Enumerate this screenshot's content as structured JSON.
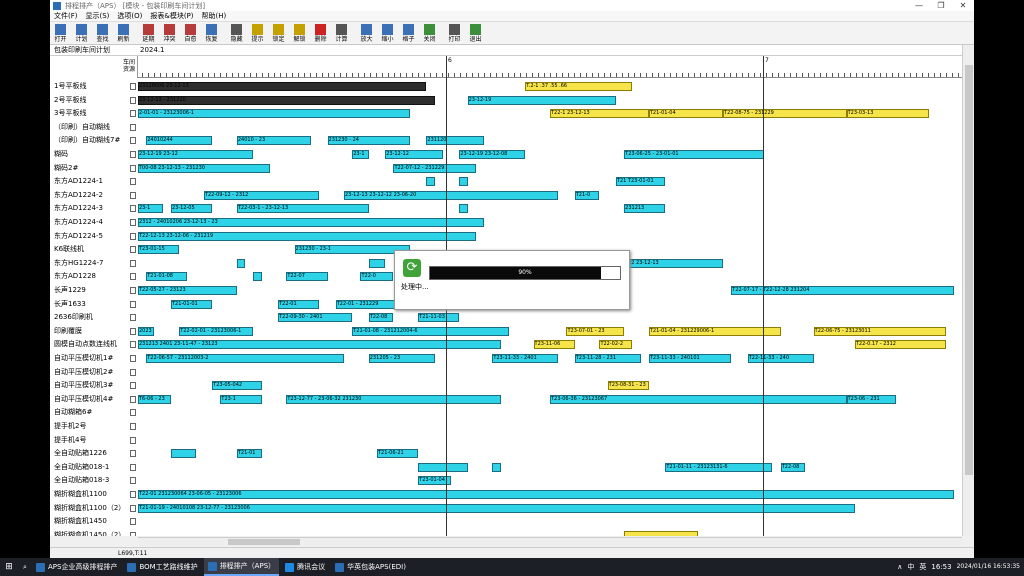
{
  "window": {
    "title": "排程排产（APS）  [模块 - 包装印刷车间计划]",
    "controls": [
      "—",
      "❐",
      "✕"
    ]
  },
  "menu": [
    "文件(F)",
    "显示(S)",
    "选项(O)",
    "报表&模块(P)",
    "帮助(H)"
  ],
  "toolbar": [
    {
      "label": "打开",
      "icon": "open-icon",
      "color": "#3b6fb6"
    },
    {
      "label": "计划",
      "icon": "plan-icon",
      "color": "#3b6fb6"
    },
    {
      "label": "查找",
      "icon": "find-icon",
      "color": "#3b6fb6"
    },
    {
      "label": "刷新",
      "icon": "refresh-icon",
      "color": "#3b6fb6"
    },
    {
      "label": "延期",
      "icon": "delay-icon",
      "color": "#b63b3b"
    },
    {
      "label": "冲突",
      "icon": "conflict-icon",
      "color": "#b63b3b"
    },
    {
      "label": "自愈",
      "icon": "heal-icon",
      "color": "#b63b3b"
    },
    {
      "label": "恢复",
      "icon": "restore-icon",
      "color": "#3b6fb6"
    },
    {
      "label": "隐藏",
      "icon": "hide-icon",
      "color": "#555555"
    },
    {
      "label": "提示",
      "icon": "tip-icon",
      "color": "#c4a000"
    },
    {
      "label": "锁定",
      "icon": "lock-icon",
      "color": "#c4a000"
    },
    {
      "label": "解锁",
      "icon": "unlock-icon",
      "color": "#c4a000"
    },
    {
      "label": "删除",
      "icon": "delete-icon",
      "color": "#cc2222"
    },
    {
      "label": "计算",
      "icon": "calc-icon",
      "color": "#555555"
    },
    {
      "label": "放大",
      "icon": "zoom-in-icon",
      "color": "#3b6fb6"
    },
    {
      "label": "缩小",
      "icon": "zoom-out-icon",
      "color": "#3b6fb6"
    },
    {
      "label": "格子",
      "icon": "grid-icon",
      "color": "#3b6fb6"
    },
    {
      "label": "关闭",
      "icon": "close-doc-icon",
      "color": "#3b8f3b"
    },
    {
      "label": "打印",
      "icon": "print-icon",
      "color": "#555555"
    },
    {
      "label": "退出",
      "icon": "exit-icon",
      "color": "#3b8f3b"
    }
  ],
  "plan": {
    "title": "包装印刷车间计划",
    "month": "2024.1",
    "corner_top": "车间",
    "corner_bottom": "资源",
    "ruler_labels": [
      "6",
      "7"
    ]
  },
  "resources": [
    {
      "name": "1号平板线",
      "bars": [
        {
          "s": 0.0,
          "w": 0.35,
          "c": "dark",
          "t": "23128006 23-12-13"
        },
        {
          "s": 0.47,
          "w": 0.13,
          "c": "yellow",
          "t": "T.2-1 .37 .55 .66"
        }
      ]
    },
    {
      "name": "2号平板线",
      "bars": [
        {
          "s": 0.0,
          "w": 0.36,
          "c": "dark",
          "t": "23-12-13 - 231220"
        },
        {
          "s": 0.4,
          "w": 0.18,
          "c": "cyan",
          "t": "23-12-19"
        }
      ]
    },
    {
      "name": "3号平板线",
      "bars": [
        {
          "s": 0.0,
          "w": 0.33,
          "c": "cyan",
          "t": "2-01-01 - 23123006-1"
        },
        {
          "s": 0.5,
          "w": 0.12,
          "c": "yellow",
          "t": "T22-1 23-12-13"
        },
        {
          "s": 0.62,
          "w": 0.09,
          "c": "yellow",
          "t": "T21-01-04"
        },
        {
          "s": 0.71,
          "w": 0.15,
          "c": "yellow",
          "t": "T22-08-75 - 231229"
        },
        {
          "s": 0.86,
          "w": 0.1,
          "c": "yellow",
          "t": "T23-03-13"
        }
      ]
    },
    {
      "name": "（印刷）自动糊线",
      "bars": []
    },
    {
      "name": "（印刷）自动糊线7#",
      "bars": [
        {
          "s": 0.01,
          "w": 0.08,
          "c": "cyan",
          "t": "24010244"
        },
        {
          "s": 0.12,
          "w": 0.09,
          "c": "cyan",
          "t": "24010 - 23"
        },
        {
          "s": 0.23,
          "w": 0.1,
          "c": "cyan",
          "t": "231230 - 24"
        },
        {
          "s": 0.35,
          "w": 0.07,
          "c": "cyan",
          "t": "231120"
        }
      ]
    },
    {
      "name": "糊码",
      "bars": [
        {
          "s": 0.0,
          "w": 0.14,
          "c": "cyan",
          "t": "23-12-19 23-12"
        },
        {
          "s": 0.26,
          "w": 0.02,
          "c": "cyan",
          "t": "23-1"
        },
        {
          "s": 0.3,
          "w": 0.07,
          "c": "cyan",
          "t": "23-12-12"
        },
        {
          "s": 0.39,
          "w": 0.08,
          "c": "cyan",
          "t": "23-12-19 23-12-08"
        },
        {
          "s": 0.59,
          "w": 0.17,
          "c": "cyan",
          "t": "T23-06-25 - 23-01-01"
        }
      ]
    },
    {
      "name": "糊码2#",
      "bars": [
        {
          "s": 0.0,
          "w": 0.16,
          "c": "cyan",
          "t": "T00-08 23-12-13 - 231230"
        },
        {
          "s": 0.31,
          "w": 0.1,
          "c": "cyan",
          "t": "T22-07-12 - 231229"
        }
      ]
    },
    {
      "name": "东方AD1224-1",
      "bars": [
        {
          "s": 0.35,
          "w": 0.01,
          "c": "cyan",
          "t": ""
        },
        {
          "s": 0.39,
          "w": 0.01,
          "c": "cyan",
          "t": ""
        },
        {
          "s": 0.58,
          "w": 0.06,
          "c": "cyan",
          "t": "T21 T23-01-01"
        }
      ]
    },
    {
      "name": "东方AD1224-2",
      "bars": [
        {
          "s": 0.08,
          "w": 0.14,
          "c": "cyan",
          "t": "T22-09-12 - 2312"
        },
        {
          "s": 0.25,
          "w": 0.26,
          "c": "cyan",
          "t": "23-12-13 23-12-12 23-06-20"
        },
        {
          "s": 0.53,
          "w": 0.03,
          "c": "cyan",
          "t": "T21-0"
        }
      ]
    },
    {
      "name": "东方AD1224-3",
      "bars": [
        {
          "s": 0.0,
          "w": 0.03,
          "c": "cyan",
          "t": "23-1"
        },
        {
          "s": 0.04,
          "w": 0.05,
          "c": "cyan",
          "t": "23-12-05"
        },
        {
          "s": 0.12,
          "w": 0.16,
          "c": "cyan",
          "t": "T22-03-1 - 23-12-13"
        },
        {
          "s": 0.39,
          "w": 0.01,
          "c": "cyan",
          "t": ""
        },
        {
          "s": 0.59,
          "w": 0.05,
          "c": "cyan",
          "t": "231213"
        }
      ]
    },
    {
      "name": "东方AD1224-4",
      "bars": [
        {
          "s": 0.0,
          "w": 0.42,
          "c": "cyan",
          "t": "2312 - 24010206 23-12-13 - 23"
        }
      ]
    },
    {
      "name": "东方AD1224-5",
      "bars": [
        {
          "s": 0.0,
          "w": 0.41,
          "c": "cyan",
          "t": "T22-12-13 23-12-06 - 231219"
        }
      ]
    },
    {
      "name": "K6联线机",
      "bars": [
        {
          "s": 0.0,
          "w": 0.05,
          "c": "cyan",
          "t": "T23-01-15"
        },
        {
          "s": 0.19,
          "w": 0.14,
          "c": "cyan",
          "t": "231230 - 23-1"
        }
      ]
    },
    {
      "name": "东方HG1224-7",
      "bars": [
        {
          "s": 0.12,
          "w": 0.01,
          "c": "cyan",
          "t": ""
        },
        {
          "s": 0.28,
          "w": 0.02,
          "c": "cyan",
          "t": ""
        },
        {
          "s": 0.57,
          "w": 0.14,
          "c": "cyan",
          "t": "T23-12-22 23-12-13"
        }
      ]
    },
    {
      "name": "东方AD1228",
      "bars": [
        {
          "s": 0.01,
          "w": 0.05,
          "c": "cyan",
          "t": "T21-01-08"
        },
        {
          "s": 0.14,
          "w": 0.01,
          "c": "cyan",
          "t": ""
        },
        {
          "s": 0.18,
          "w": 0.05,
          "c": "cyan",
          "t": "T22-07"
        },
        {
          "s": 0.27,
          "w": 0.04,
          "c": "cyan",
          "t": "T22-0"
        }
      ]
    },
    {
      "name": "长声1229",
      "bars": [
        {
          "s": 0.0,
          "w": 0.12,
          "c": "cyan",
          "t": "T22-05-27 - 23123"
        },
        {
          "s": 0.52,
          "w": 0.07,
          "c": "cyan",
          "t": "23-12-13"
        },
        {
          "s": 0.72,
          "w": 0.27,
          "c": "cyan",
          "t": "T22-07-17 - T22-12-28 231204"
        }
      ]
    },
    {
      "name": "长声1633",
      "bars": [
        {
          "s": 0.04,
          "w": 0.05,
          "c": "cyan",
          "t": "T21-01-01"
        },
        {
          "s": 0.17,
          "w": 0.05,
          "c": "cyan",
          "t": "T22-01"
        },
        {
          "s": 0.24,
          "w": 0.11,
          "c": "cyan",
          "t": "T22-01 - 231229"
        }
      ]
    },
    {
      "name": "2636印刷机",
      "bars": [
        {
          "s": 0.17,
          "w": 0.09,
          "c": "cyan",
          "t": "T22-09-30 - 2401"
        },
        {
          "s": 0.28,
          "w": 0.03,
          "c": "cyan",
          "t": "T22-08"
        },
        {
          "s": 0.34,
          "w": 0.05,
          "c": "cyan",
          "t": "T21-11-03"
        }
      ]
    },
    {
      "name": "印刷覆膜",
      "bars": [
        {
          "s": 0.0,
          "w": 0.02,
          "c": "cyan",
          "t": "2023"
        },
        {
          "s": 0.05,
          "w": 0.09,
          "c": "cyan",
          "t": "T22-02-01 - 23123006-1"
        },
        {
          "s": 0.26,
          "w": 0.19,
          "c": "cyan",
          "t": "T21-01-08 - 231212004-6"
        },
        {
          "s": 0.52,
          "w": 0.07,
          "c": "yellow",
          "t": "T23-07-01 - 23"
        },
        {
          "s": 0.62,
          "w": 0.16,
          "c": "yellow",
          "t": "T21-01-04 - 231229006-1"
        },
        {
          "s": 0.82,
          "w": 0.16,
          "c": "yellow",
          "t": "T22-06-75 - 23123011"
        }
      ]
    },
    {
      "name": "圆模自动点数连线机",
      "bars": [
        {
          "s": 0.0,
          "w": 0.44,
          "c": "cyan",
          "t": "231213 2401 23-11-47 - 23123"
        },
        {
          "s": 0.48,
          "w": 0.05,
          "c": "yellow",
          "t": "T23-11-06"
        },
        {
          "s": 0.56,
          "w": 0.04,
          "c": "yellow",
          "t": "T22-02-2"
        },
        {
          "s": 0.87,
          "w": 0.11,
          "c": "yellow",
          "t": "T22-0.17 - 2312"
        }
      ]
    },
    {
      "name": "自动平压模切机1#",
      "bars": [
        {
          "s": 0.01,
          "w": 0.24,
          "c": "cyan",
          "t": "T22-06-57 - 23112003-2"
        },
        {
          "s": 0.28,
          "w": 0.08,
          "c": "cyan",
          "t": "231205 - 23"
        },
        {
          "s": 0.43,
          "w": 0.08,
          "c": "cyan",
          "t": "T23-11-33 - 2401"
        },
        {
          "s": 0.53,
          "w": 0.08,
          "c": "cyan",
          "t": "T23-11-28 - 231"
        },
        {
          "s": 0.62,
          "w": 0.1,
          "c": "cyan",
          "t": "T23-11-33 - 240101"
        },
        {
          "s": 0.74,
          "w": 0.08,
          "c": "cyan",
          "t": "T22-11-33 - 240"
        }
      ]
    },
    {
      "name": "自动平压模切机2#",
      "bars": []
    },
    {
      "name": "自动平压模切机3#",
      "bars": [
        {
          "s": 0.09,
          "w": 0.06,
          "c": "cyan",
          "t": "T23-05-042"
        },
        {
          "s": 0.57,
          "w": 0.05,
          "c": "yellow",
          "t": "T23-08-31 - 23"
        }
      ]
    },
    {
      "name": "自动平压模切机4#",
      "bars": [
        {
          "s": 0.0,
          "w": 0.04,
          "c": "cyan",
          "t": "T6-06 - 23"
        },
        {
          "s": 0.1,
          "w": 0.05,
          "c": "cyan",
          "t": "T23-1"
        },
        {
          "s": 0.18,
          "w": 0.26,
          "c": "cyan",
          "t": "T23-12-77 - 23-06-32 231230"
        },
        {
          "s": 0.5,
          "w": 0.36,
          "c": "cyan",
          "t": "T23-06-36 - 23123067"
        },
        {
          "s": 0.86,
          "w": 0.06,
          "c": "cyan",
          "t": "T23-06 - 231"
        }
      ]
    },
    {
      "name": "自动糊箱6#",
      "bars": []
    },
    {
      "name": "提手机2号",
      "bars": []
    },
    {
      "name": "提手机4号",
      "bars": []
    },
    {
      "name": "全自动贴箱1226",
      "bars": [
        {
          "s": 0.04,
          "w": 0.03,
          "c": "cyan",
          "t": ""
        },
        {
          "s": 0.12,
          "w": 0.03,
          "c": "cyan",
          "t": "T21-01"
        },
        {
          "s": 0.29,
          "w": 0.05,
          "c": "cyan",
          "t": "T21-06-21"
        }
      ]
    },
    {
      "name": "全自动贴箱018-1",
      "bars": [
        {
          "s": 0.34,
          "w": 0.06,
          "c": "cyan",
          "t": ""
        },
        {
          "s": 0.43,
          "w": 0.01,
          "c": "cyan",
          "t": ""
        },
        {
          "s": 0.64,
          "w": 0.13,
          "c": "cyan",
          "t": "T21-01-11 - 23123131-6"
        },
        {
          "s": 0.78,
          "w": 0.03,
          "c": "cyan",
          "t": "T22-08"
        }
      ]
    },
    {
      "name": "全自动贴箱018-3",
      "bars": [
        {
          "s": 0.34,
          "w": 0.04,
          "c": "cyan",
          "t": "T23-01-04"
        }
      ]
    },
    {
      "name": "糊折糊盒机1100",
      "bars": [
        {
          "s": 0.0,
          "w": 0.99,
          "c": "cyan",
          "t": "T22-01 231230064 23-06-05 - 23123006"
        }
      ]
    },
    {
      "name": "糊折糊盒机1100（2）",
      "bars": [
        {
          "s": 0.0,
          "w": 0.87,
          "c": "cyan",
          "t": "T21-01-19 - 24010108 23-12-77 - 23123006"
        }
      ]
    },
    {
      "name": "糊折糊盒机1450",
      "bars": []
    },
    {
      "name": "糊折糊盒机1450（2）",
      "bars": [
        {
          "s": 0.59,
          "w": 0.09,
          "c": "yellow",
          "t": ""
        }
      ]
    }
  ],
  "dialog": {
    "progress_pct": 0.9,
    "progress_text": "90%",
    "message": "处理中..."
  },
  "status": {
    "text": "L699,T:11"
  },
  "taskbar": {
    "items": [
      {
        "label": "APS企业高级排程排产",
        "active": false,
        "color": "#2a6fb5"
      },
      {
        "label": "BOM工艺路线维护",
        "active": false,
        "color": "#2a6fb5"
      },
      {
        "label": "排程排产（APS）",
        "active": true,
        "color": "#2a6fb5"
      },
      {
        "label": "腾讯会议",
        "active": false,
        "color": "#1e88e5"
      },
      {
        "label": "华英包装APS(EDI)",
        "active": false,
        "color": "#2a6fb5"
      }
    ],
    "tray": [
      "∧",
      "中",
      "英"
    ],
    "time": "16:53",
    "datetime": "2024/01/16 16:53:35"
  }
}
